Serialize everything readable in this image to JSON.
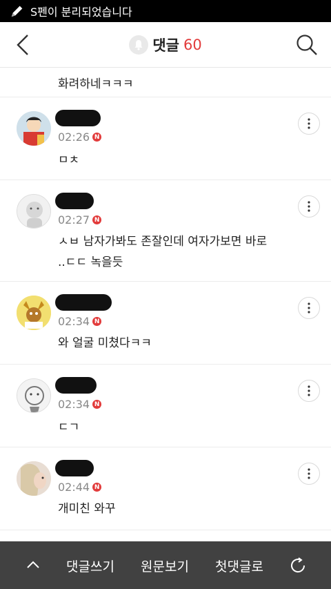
{
  "status_bar": {
    "text": "S펜이 분리되었습니다"
  },
  "header": {
    "title": "댓글",
    "count": "60"
  },
  "top_comment": {
    "text": "화려하네ㅋㅋㅋ"
  },
  "comments": [
    {
      "time": "02:26",
      "badge": "N",
      "lines": [
        "ㅁㅊ"
      ]
    },
    {
      "time": "02:27",
      "badge": "N",
      "lines": [
        "ㅅㅂ 남자가봐도 존잘인데 여자가보면 바로",
        "..ㄷㄷ 녹을듯"
      ]
    },
    {
      "time": "02:34",
      "badge": "N",
      "lines": [
        "와 얼굴 미쳤다ㅋㅋ"
      ]
    },
    {
      "time": "02:34",
      "badge": "N",
      "lines": [
        "ㄷㄱ"
      ]
    },
    {
      "time": "02:44",
      "badge": "N",
      "lines": [
        "개미친 와꾸"
      ]
    }
  ],
  "bottom_bar": {
    "write": "댓글쓰기",
    "original": "원문보기",
    "first": "첫댓글로"
  }
}
